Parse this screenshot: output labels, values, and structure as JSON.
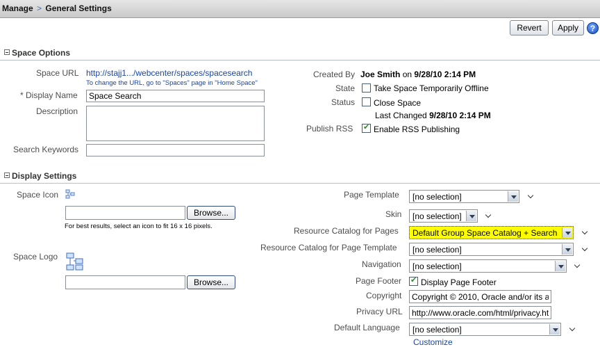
{
  "breadcrumb": {
    "parent": "Manage",
    "separator": ">",
    "current": "General Settings"
  },
  "toolbar": {
    "revert_label": "Revert",
    "apply_label": "Apply",
    "help_icon": "?"
  },
  "space_options": {
    "title": "Space Options",
    "space_url": {
      "label": "Space URL",
      "value": "http://stajj1.../webcenter/spaces/spacesearch",
      "hint": "To change the URL, go to \"Spaces\" page in \"Home Space\""
    },
    "display_name": {
      "label": "* Display Name",
      "value": "Space Search"
    },
    "description": {
      "label": "Description",
      "value": ""
    },
    "search_keywords": {
      "label": "Search Keywords",
      "value": ""
    },
    "created_by": {
      "label": "Created By",
      "user": "Joe Smith",
      "on_word": "on",
      "date": "9/28/10 2:14 PM"
    },
    "state": {
      "label": "State",
      "option": "Take Space Temporarily Offline",
      "checked": false
    },
    "status": {
      "label": "Status",
      "option": "Close Space",
      "checked": false,
      "last_changed_label": "Last Changed",
      "last_changed": "9/28/10 2:14 PM"
    },
    "publish_rss": {
      "label": "Publish RSS",
      "option": "Enable RSS Publishing",
      "checked": true
    }
  },
  "display_settings": {
    "title": "Display Settings",
    "space_icon": {
      "label": "Space Icon",
      "file_value": "",
      "browse_label": "Browse...",
      "hint": "For best results, select an icon to fit 16 x 16 pixels."
    },
    "space_logo": {
      "label": "Space Logo",
      "file_value": "",
      "browse_label": "Browse..."
    },
    "page_template": {
      "label": "Page Template",
      "value": "[no selection]"
    },
    "skin": {
      "label": "Skin",
      "value": "[no selection]"
    },
    "resource_catalog_pages": {
      "label": "Resource Catalog for Pages",
      "value": "Default Group Space Catalog + Search",
      "highlight": "#ffff00"
    },
    "resource_catalog_template": {
      "label": "Resource Catalog for Page Template",
      "value": "[no selection]"
    },
    "navigation": {
      "label": "Navigation",
      "value": "[no selection]"
    },
    "page_footer": {
      "label": "Page Footer",
      "option": "Display Page Footer",
      "checked": true
    },
    "copyright": {
      "label": "Copyright",
      "value": "Copyright © 2010, Oracle and/or its a"
    },
    "privacy_url": {
      "label": "Privacy URL",
      "value": "http://www.oracle.com/html/privacy.ht"
    },
    "default_language": {
      "label": "Default Language",
      "value": "[no selection]"
    },
    "customize_label": "Customize"
  },
  "colors": {
    "link": "#1a45a3",
    "label": "#4d4d4d",
    "highlight": "#ffff00"
  }
}
